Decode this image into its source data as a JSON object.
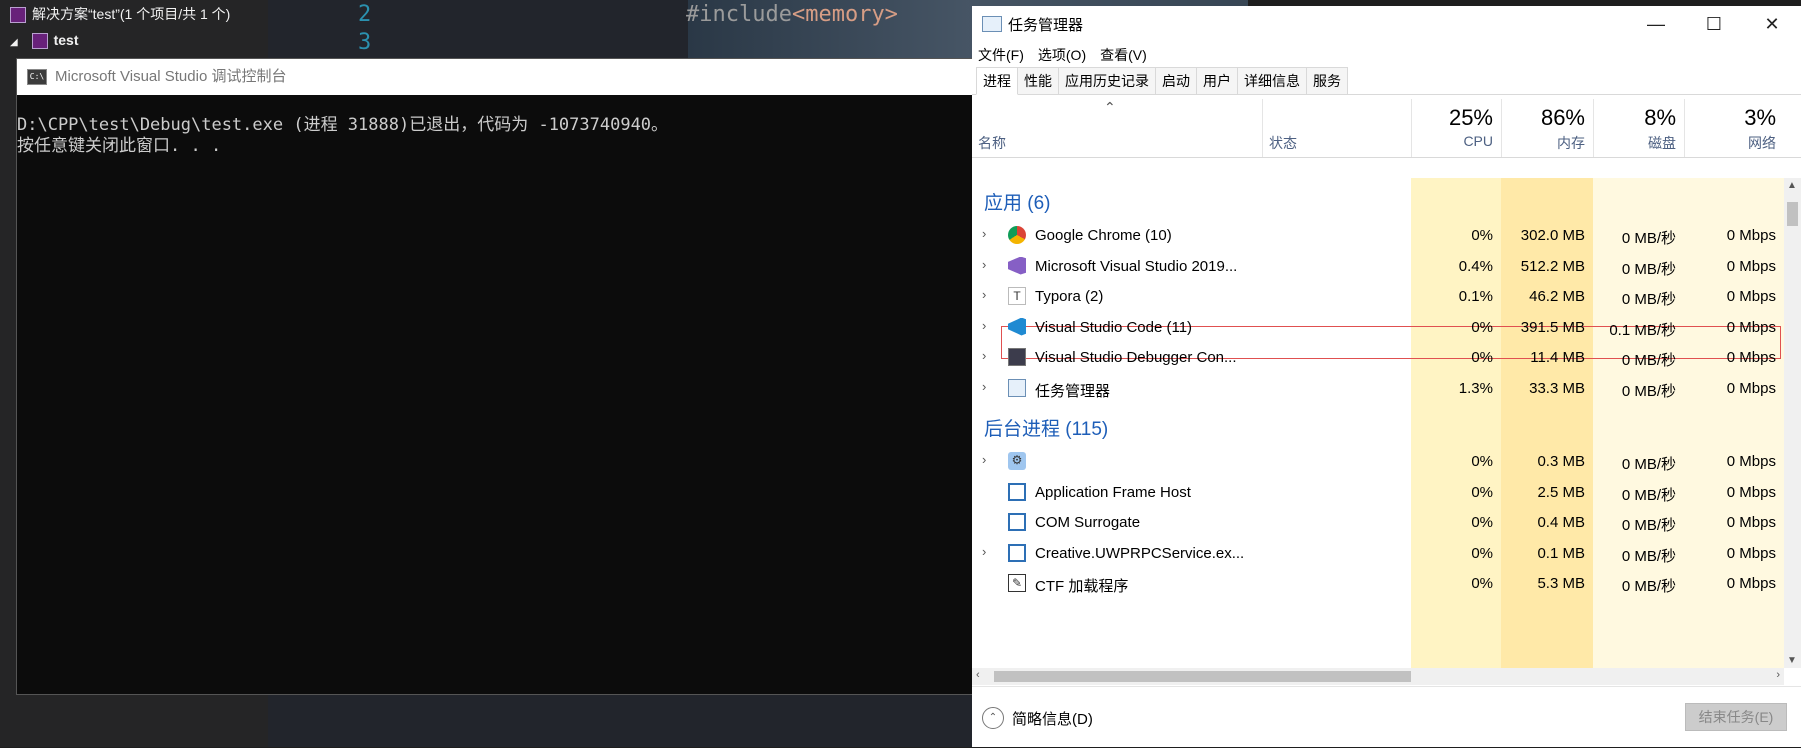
{
  "vs": {
    "solution_title": "解决方案“test”(1 个项目/共 1 个)",
    "project_name": "test",
    "line_numbers": [
      "2",
      "3"
    ],
    "code_line": "#include",
    "code_token": "<memory>"
  },
  "console": {
    "title": "Microsoft Visual Studio 调试控制台",
    "icon_text": "C:\\",
    "lines": [
      "D:\\CPP\\test\\Debug\\test.exe (进程 31888)已退出，代码为 -1073740940。",
      "按任意键关闭此窗口. . ."
    ]
  },
  "taskmgr": {
    "title": "任务管理器",
    "window_buttons": [
      "—",
      "☐",
      "✕"
    ],
    "menu": [
      "文件(F)",
      "选项(O)",
      "查看(V)"
    ],
    "tabs": [
      "进程",
      "性能",
      "应用历史记录",
      "启动",
      "用户",
      "详细信息",
      "服务"
    ],
    "active_tab": "进程",
    "headers": {
      "name": "名称",
      "status": "状态",
      "cpu_pct": "25%",
      "cpu": "CPU",
      "mem_pct": "86%",
      "mem": "内存",
      "disk_pct": "8%",
      "disk": "磁盘",
      "net_pct": "3%",
      "net": "网络"
    },
    "groups": [
      {
        "label": "应用 (6)"
      },
      {
        "label": "后台进程 (115)"
      }
    ],
    "apps": [
      {
        "name": "Google Chrome (10)",
        "cpu": "0%",
        "mem": "302.0 MB",
        "disk": "0 MB/秒",
        "net": "0 Mbps",
        "icon": "chrome-icon",
        "expandable": true
      },
      {
        "name": "Microsoft Visual Studio 2019...",
        "cpu": "0.4%",
        "mem": "512.2 MB",
        "disk": "0 MB/秒",
        "net": "0 Mbps",
        "icon": "visual-studio-icon",
        "expandable": true
      },
      {
        "name": "Typora (2)",
        "cpu": "0.1%",
        "mem": "46.2 MB",
        "disk": "0 MB/秒",
        "net": "0 Mbps",
        "icon": "typora-icon",
        "expandable": true
      },
      {
        "name": "Visual Studio Code (11)",
        "cpu": "0%",
        "mem": "391.5 MB",
        "disk": "0.1 MB/秒",
        "net": "0 Mbps",
        "icon": "vscode-icon",
        "expandable": true
      },
      {
        "name": "Visual Studio Debugger Con...",
        "cpu": "0%",
        "mem": "11.4 MB",
        "disk": "0 MB/秒",
        "net": "0 Mbps",
        "icon": "console-icon",
        "expandable": true
      },
      {
        "name": "任务管理器",
        "cpu": "1.3%",
        "mem": "33.3 MB",
        "disk": "0 MB/秒",
        "net": "0 Mbps",
        "icon": "task-manager-icon",
        "expandable": true
      }
    ],
    "background": [
      {
        "name": "",
        "cpu": "0%",
        "mem": "0.3 MB",
        "disk": "0 MB/秒",
        "net": "0 Mbps",
        "icon": "gear-icon",
        "expandable": true
      },
      {
        "name": "Application Frame Host",
        "cpu": "0%",
        "mem": "2.5 MB",
        "disk": "0 MB/秒",
        "net": "0 Mbps",
        "icon": "app-window-icon",
        "expandable": false
      },
      {
        "name": "COM Surrogate",
        "cpu": "0%",
        "mem": "0.4 MB",
        "disk": "0 MB/秒",
        "net": "0 Mbps",
        "icon": "app-window-icon",
        "expandable": false
      },
      {
        "name": "Creative.UWPRPCService.ex...",
        "cpu": "0%",
        "mem": "0.1 MB",
        "disk": "0 MB/秒",
        "net": "0 Mbps",
        "icon": "app-window-icon",
        "expandable": true
      },
      {
        "name": "CTF 加载程序",
        "cpu": "0%",
        "mem": "5.3 MB",
        "disk": "0 MB/秒",
        "net": "0 Mbps",
        "icon": "ctf-icon",
        "expandable": false
      }
    ],
    "footer": {
      "fewer_details": "简略信息(D)",
      "end_task": "结束任务(E)"
    },
    "colors": {
      "group_blue": "#1e5eb8",
      "cpu_bg": "#fff4c4",
      "mem_bg": "#ffe9a8",
      "light_bg": "#fff9e0",
      "highlight_border": "#e05050"
    }
  }
}
